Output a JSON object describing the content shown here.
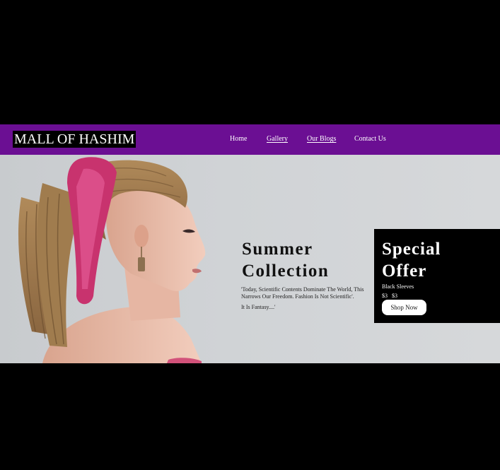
{
  "brand": {
    "name": "MALL OF HASHIM"
  },
  "nav": {
    "items": [
      {
        "label": "Home"
      },
      {
        "label": "Gallery"
      },
      {
        "label": "Our Blogs"
      },
      {
        "label": "Contact Us"
      }
    ]
  },
  "hero": {
    "title_line1": "Summer",
    "title_line2": "Collection",
    "quote_line1": "'Today, Scientific Contents Dominate The World, This Narrows Our Freedom. Fashion Is Not Scientific'.",
    "quote_line2": "It Is Fantasy....'"
  },
  "offer": {
    "title_line1": "Special",
    "title_line2": "Offer",
    "item": "Black Sleeves",
    "old_price": "$3",
    "new_price": "$3",
    "button_label": "Shop Now"
  },
  "colors": {
    "navbar": "#6b0f93",
    "page_background": "#000000",
    "hero_background": "#d0d3d6",
    "offer_box": "#000000"
  },
  "icons": {
    "hero_image": "woman-with-braided-hair-photo"
  }
}
